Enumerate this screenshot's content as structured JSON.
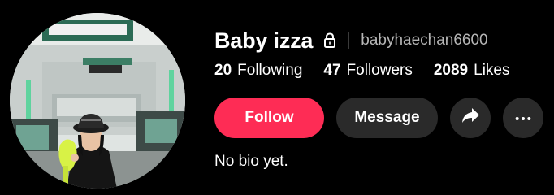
{
  "profile": {
    "display_name": "Baby izza",
    "username": "babyhaechan6600",
    "bio": "No bio yet.",
    "avatar_icon": "profile-photo",
    "lock_icon": "lock-icon"
  },
  "stats": {
    "following_count": "20",
    "following_label": "Following",
    "followers_count": "47",
    "followers_label": "Followers",
    "likes_count": "2089",
    "likes_label": "Likes"
  },
  "actions": {
    "follow_label": "Follow",
    "message_label": "Message",
    "share_icon": "share-arrow-icon",
    "more_icon": "more-dots-icon"
  },
  "colors": {
    "background": "#000000",
    "follow_button": "#fe2c55",
    "secondary_button": "#2a2a2a",
    "username_text": "#b6b6b6"
  }
}
